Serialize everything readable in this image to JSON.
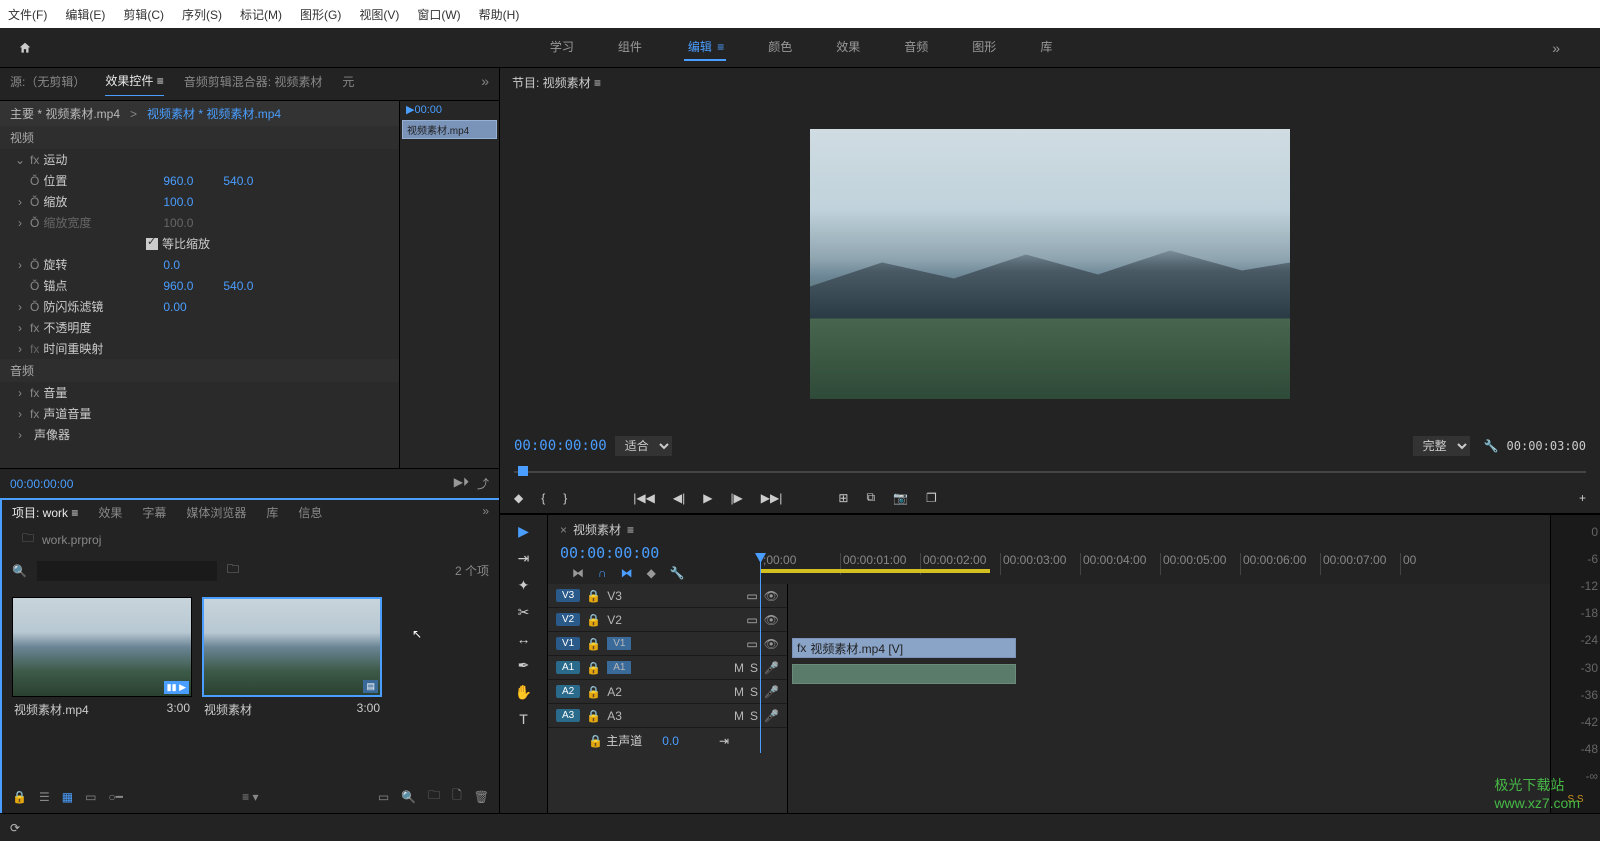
{
  "menubar": [
    "文件(F)",
    "编辑(E)",
    "剪辑(C)",
    "序列(S)",
    "标记(M)",
    "图形(G)",
    "视图(V)",
    "窗口(W)",
    "帮助(H)"
  ],
  "workspaces": {
    "items": [
      "学习",
      "组件",
      "编辑",
      "颜色",
      "效果",
      "音频",
      "图形",
      "库"
    ],
    "active": "编辑",
    "more": "»"
  },
  "source_tabs": {
    "items": [
      "源:（无剪辑）",
      "效果控件",
      "音频剪辑混合器: 视频素材",
      "元"
    ],
    "active": "效果控件",
    "more": "»"
  },
  "effect": {
    "master": "主要 * 视频素材.mp4",
    "sub": "视频素材 * 视频素材.mp4",
    "video_header": "视频",
    "motion": "运动",
    "position": {
      "label": "位置",
      "x": "960.0",
      "y": "540.0"
    },
    "scale": {
      "label": "缩放",
      "v": "100.0"
    },
    "scalew": {
      "label": "缩放宽度",
      "v": "100.0"
    },
    "uniform": "等比缩放",
    "rotation": {
      "label": "旋转",
      "v": "0.0"
    },
    "anchor": {
      "label": "锚点",
      "x": "960.0",
      "y": "540.0"
    },
    "antiflicker": {
      "label": "防闪烁滤镜",
      "v": "0.00"
    },
    "opacity": "不透明度",
    "timeremap": "时间重映射",
    "audio_header": "音频",
    "volume": "音量",
    "chvolume": "声道音量",
    "panner": "声像器",
    "mini_tc": "▶00:00",
    "mini_clip": "视频素材.mp4",
    "timecode": "00:00:00:00"
  },
  "program": {
    "title": "节目: 视频素材",
    "tc": "00:00:00:00",
    "fit": "适合",
    "quality": "完整",
    "duration": "00:00:03:00"
  },
  "transport": [
    "◆",
    "{",
    "}",
    "|◀◀",
    "◀|",
    "▶",
    "|▶",
    "▶▶|",
    "⊞",
    "⧉",
    "📷",
    "❐"
  ],
  "project": {
    "tabs": [
      "项目: work",
      "效果",
      "字幕",
      "媒体浏览器",
      "库",
      "信息"
    ],
    "active": "项目: work",
    "more": "»",
    "path": "work.prproj",
    "search_placeholder": "",
    "count": "2 个项",
    "bins": [
      {
        "name": "视频素材.mp4",
        "dur": "3:00"
      },
      {
        "name": "视频素材",
        "dur": "3:00"
      }
    ]
  },
  "timeline": {
    "title": "视频素材",
    "tc": "00:00:00:00",
    "ruler": [
      ";00:00",
      "00:00:01:00",
      "00:00:02:00",
      "00:00:03:00",
      "00:00:04:00",
      "00:00:05:00",
      "00:00:06:00",
      "00:00:07:00",
      "00"
    ],
    "tracks": {
      "v": [
        "V3",
        "V2",
        "V1"
      ],
      "a": [
        "A1",
        "A2",
        "A3"
      ]
    },
    "clip_v": "视频素材.mp4 [V]",
    "master": "主声道",
    "master_val": "0.0"
  },
  "meter_labels": [
    "0",
    "-6",
    "-12",
    "-18",
    "-24",
    "-30",
    "-36",
    "-42",
    "-48",
    "-∞"
  ],
  "meter_ss": "S  S",
  "watermark": "极光下载站\nwww.xz7.com"
}
